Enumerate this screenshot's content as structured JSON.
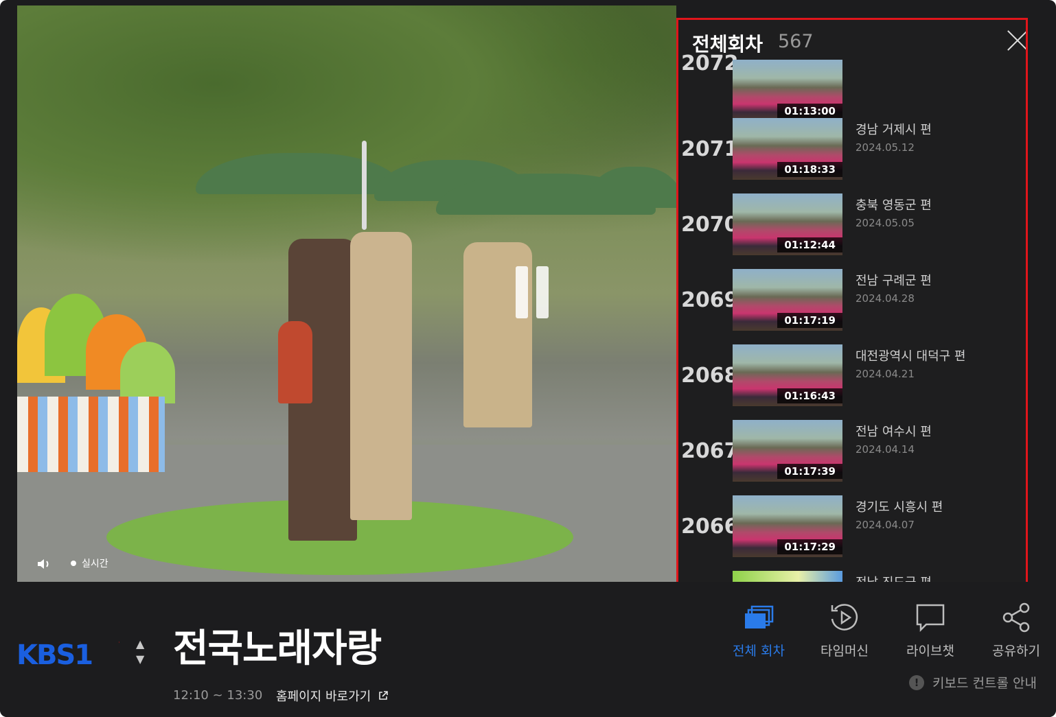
{
  "player": {
    "live_label": "실시간"
  },
  "panel": {
    "title": "전체회차",
    "count": "567",
    "episodes": [
      {
        "number": "2072",
        "title": "",
        "date": "",
        "duration": "01:13:00"
      },
      {
        "number": "2071",
        "title": "경남 거제시 편",
        "date": "2024.05.12",
        "duration": "01:18:33"
      },
      {
        "number": "2070",
        "title": "충북 영동군 편",
        "date": "2024.05.05",
        "duration": "01:12:44"
      },
      {
        "number": "2069",
        "title": "전남 구례군 편",
        "date": "2024.04.28",
        "duration": "01:17:19"
      },
      {
        "number": "2068",
        "title": "대전광역시 대덕구 편",
        "date": "2024.04.21",
        "duration": "01:16:43"
      },
      {
        "number": "2067",
        "title": "전남 여수시 편",
        "date": "2024.04.14",
        "duration": "01:17:39"
      },
      {
        "number": "2066",
        "title": "경기도 시흥시 편",
        "date": "2024.04.07",
        "duration": "01:17:29"
      },
      {
        "number": "",
        "title": "전남 진도군 편",
        "date": "",
        "duration": ""
      }
    ]
  },
  "program": {
    "channel_logo": "KBS1",
    "title": "전국노래자랑",
    "time_range": "12:10 ~ 13:30",
    "homepage_link": "홈페이지 바로가기"
  },
  "controls": {
    "all_episodes": "전체 회차",
    "time_machine": "타임머신",
    "live_chat": "라이브챗",
    "share": "공유하기",
    "keyboard_guide": "키보드 컨트롤 안내"
  },
  "colors": {
    "accent": "#2a7bea",
    "highlight_border": "#e0151b",
    "background": "#1c1c1e"
  }
}
